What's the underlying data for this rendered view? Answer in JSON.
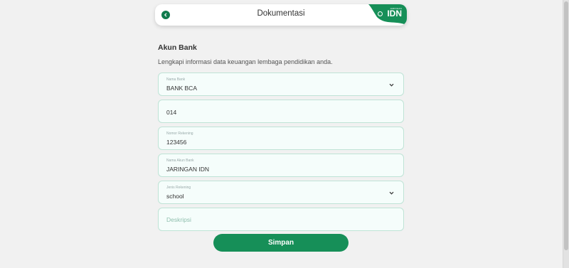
{
  "header": {
    "title": "Dokumentasi",
    "brand_small": "JARINGAN",
    "brand_name": "IDN"
  },
  "section": {
    "title": "Akun Bank",
    "subtitle": "Lengkapi informasi data keuangan lembaga pendidikan anda."
  },
  "form": {
    "bank": {
      "label": "Nama Bank",
      "value": "BANK BCA"
    },
    "bank_code": {
      "value": "014"
    },
    "account_number": {
      "label": "Nomor Rekening",
      "value": "123456"
    },
    "account_name": {
      "label": "Nama Akun Bank",
      "value": "JARINGAN IDN"
    },
    "account_type": {
      "label": "Jenis Rekening",
      "value": "school"
    },
    "description": {
      "placeholder": "Deskripsi"
    }
  },
  "actions": {
    "save_label": "Simpan"
  },
  "colors": {
    "accent": "#168f58",
    "field_bg": "#f5fdfb",
    "field_border": "#bfe3d6"
  }
}
